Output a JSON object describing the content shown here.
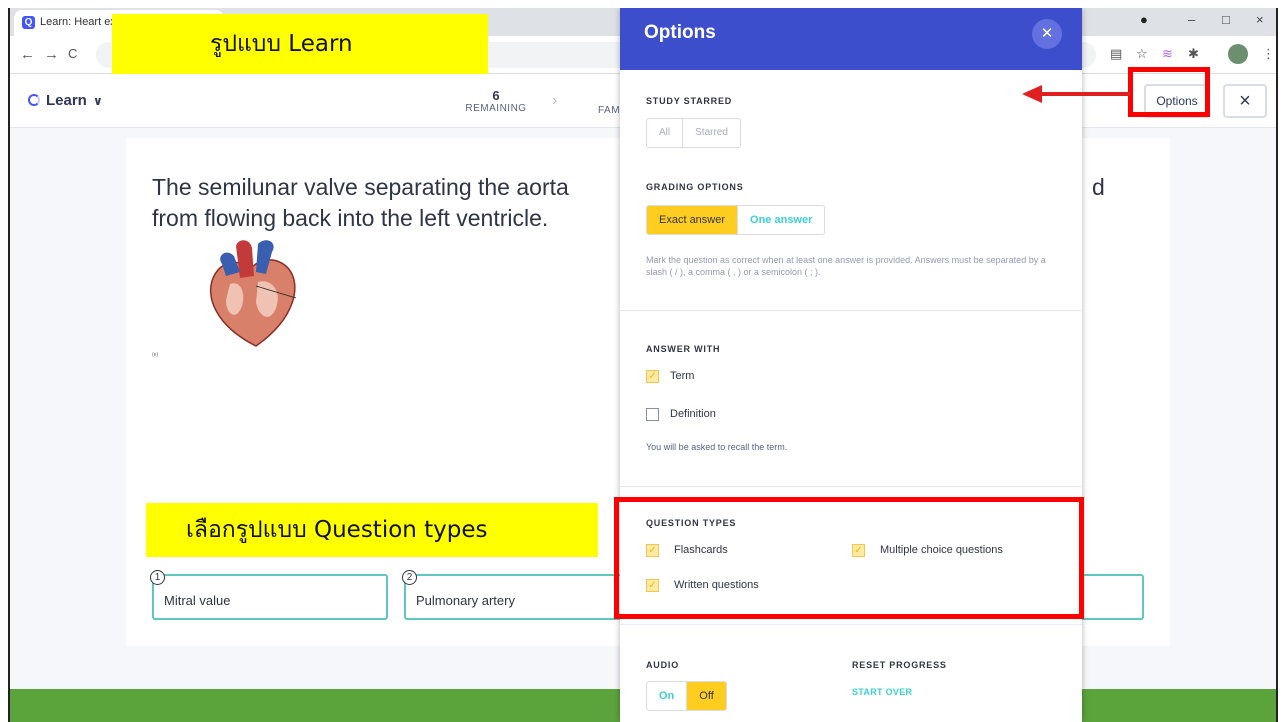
{
  "browser": {
    "tab_title": "Learn: Heart exa",
    "tab_icon": "Q",
    "window_controls": [
      "–",
      "□",
      "×"
    ],
    "nav": [
      "←",
      "→",
      "C"
    ]
  },
  "header": {
    "mode_label": "Learn",
    "remaining_count": "6",
    "remaining_label": "REMAINING",
    "next_stage_label": "FAM",
    "options_button": "Options",
    "close_button": "×"
  },
  "question": {
    "prompt_text": "The semilunar valve separating the aorta",
    "prompt_tail": "d",
    "prompt_line2": "from flowing back into the left ventricle.",
    "image_caption": "(e)",
    "choices": [
      {
        "num": "1",
        "label": "Mitral value"
      },
      {
        "num": "2",
        "label": "Pulmonary artery"
      }
    ]
  },
  "options": {
    "title": "Options",
    "study_starred": {
      "heading": "STUDY STARRED",
      "choices": [
        "All",
        "Starred"
      ]
    },
    "grading": {
      "heading": "GRADING OPTIONS",
      "choices": [
        "Exact answer",
        "One answer"
      ],
      "help": "Mark the question as correct when at least one answer is provided. Answers must be separated by a slash ( / ), a comma ( , ) or a semicolon ( ; )."
    },
    "answer_with": {
      "heading": "ANSWER WITH",
      "items": [
        {
          "label": "Term",
          "checked": true
        },
        {
          "label": "Definition",
          "checked": false
        }
      ],
      "note": "You will be asked to recall the term."
    },
    "question_types": {
      "heading": "QUESTION TYPES",
      "items": [
        {
          "label": "Flashcards",
          "checked": true
        },
        {
          "label": "Multiple choice questions",
          "checked": true
        },
        {
          "label": "Written questions",
          "checked": true
        }
      ]
    },
    "audio": {
      "heading": "AUDIO",
      "choices": [
        "On",
        "Off"
      ],
      "selected": "Off"
    },
    "reset": {
      "heading": "RESET PROGRESS",
      "action": "START OVER"
    }
  },
  "annotations": {
    "learn_format_label": "รูปแบบ Learn",
    "question_types_label": "เลือกรูปแบบ Question types",
    "highlight_color": "#ffff00",
    "box_color": "#ff0000"
  },
  "colors": {
    "panel_header": "#3d4ecc",
    "selected_segment": "#ffcd1f",
    "accent_teal": "#3ccfcf",
    "footer_green": "#5ba33b"
  }
}
